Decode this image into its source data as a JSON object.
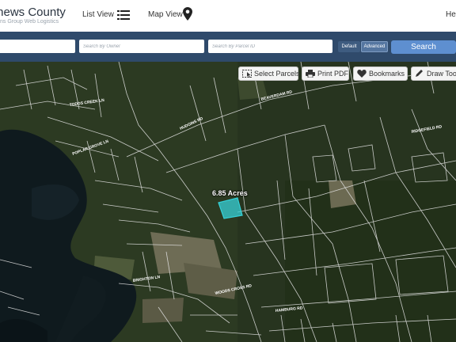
{
  "header": {
    "title": "thews County",
    "subtitle": "ns Group Web Logistics",
    "nav_list": "List View",
    "nav_map": "Map View",
    "nav_help": "Help"
  },
  "search": {
    "field1_placeholder": "",
    "owner_placeholder": "Search By Owner",
    "parcel_placeholder": "Search By Parcel ID",
    "mode_default": "Default",
    "mode_advanced": "Advanced",
    "search_label": "Search"
  },
  "tools": {
    "select": "Select Parcels",
    "print": "Print PDF",
    "bookmarks": "Bookmarks",
    "draw": "Draw Tools"
  },
  "map": {
    "highlight_label": "6.85 Acres",
    "highlight_color": "#35d1d8",
    "road_labels": [
      "BEAVERDAM RD",
      "TODDS CREEK LN",
      "POPLAR GROVE LN",
      "HUDGINS RD",
      "RIDGEFIELD RD",
      "BRIGHTON LN",
      "HAMBURG RD",
      "WOODS CROSS RD"
    ]
  }
}
